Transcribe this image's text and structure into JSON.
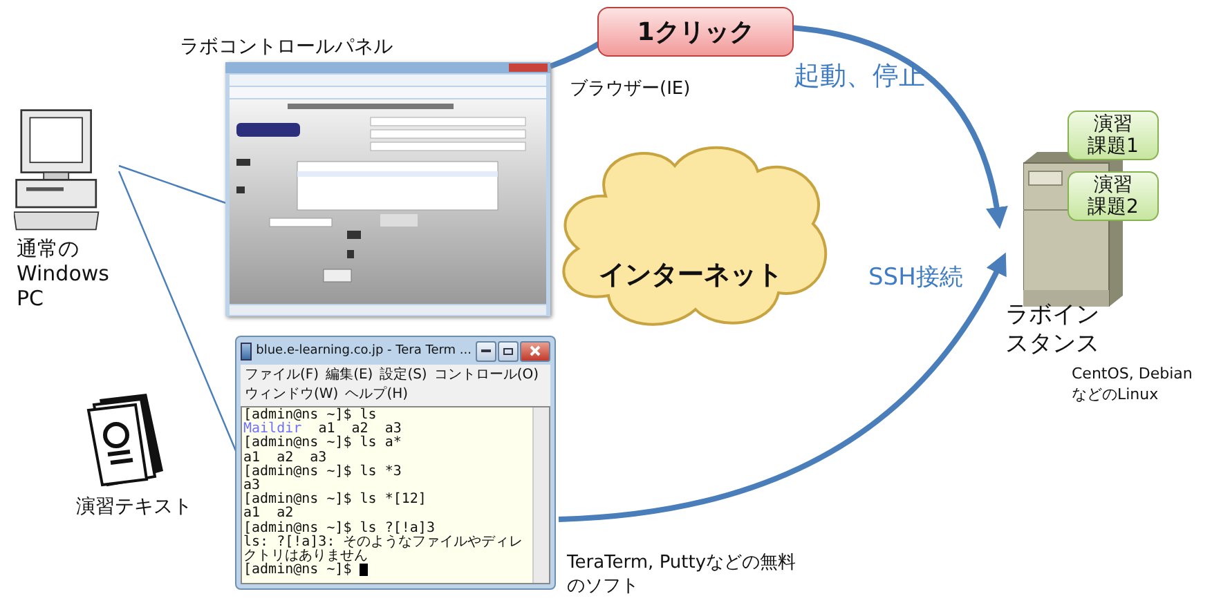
{
  "control_panel": {
    "caption": "ラボコントロールパネル",
    "browser_caption": "ブラウザー(IE)"
  },
  "one_click": {
    "label": "1クリック"
  },
  "start_stop_label": "起動、停止",
  "internet": {
    "label": "インターネット"
  },
  "ssh_label": "SSH接続",
  "client_pc": {
    "label": [
      "通常の",
      "Windows",
      "PC"
    ]
  },
  "textbook": {
    "label": "演習テキスト"
  },
  "terminal": {
    "title": "blue.e-learning.co.jp - Tera Term ...",
    "menu_rows": [
      [
        "ファイル(F)",
        "編集(E)",
        "設定(S)",
        "コントロール(O)"
      ],
      [
        "ウィンドウ(W)",
        "ヘルプ(H)"
      ]
    ],
    "lines": [
      {
        "parts": [
          {
            "kind": "plain",
            "text": "[admin@ns ~]$ ls"
          }
        ],
        "cursor": false
      },
      {
        "parts": [
          {
            "kind": "dir",
            "text": "Maildir"
          },
          {
            "kind": "plain",
            "text": "  a1  a2  a3"
          }
        ],
        "cursor": false
      },
      {
        "parts": [
          {
            "kind": "plain",
            "text": "[admin@ns ~]$ ls a*"
          }
        ],
        "cursor": false
      },
      {
        "parts": [
          {
            "kind": "plain",
            "text": "a1  a2  a3"
          }
        ],
        "cursor": false
      },
      {
        "parts": [
          {
            "kind": "plain",
            "text": "[admin@ns ~]$ ls *3"
          }
        ],
        "cursor": false
      },
      {
        "parts": [
          {
            "kind": "plain",
            "text": "a3"
          }
        ],
        "cursor": false
      },
      {
        "parts": [
          {
            "kind": "plain",
            "text": "[admin@ns ~]$ ls *[12]"
          }
        ],
        "cursor": false
      },
      {
        "parts": [
          {
            "kind": "plain",
            "text": "a1  a2"
          }
        ],
        "cursor": false
      },
      {
        "parts": [
          {
            "kind": "plain",
            "text": "[admin@ns ~]$ ls ?[!a]3"
          }
        ],
        "cursor": false
      },
      {
        "parts": [
          {
            "kind": "plain",
            "text": "ls: ?[!a]3: そのようなファイルやディレ"
          }
        ],
        "cursor": false
      },
      {
        "parts": [
          {
            "kind": "plain",
            "text": "クトリはありません"
          }
        ],
        "cursor": false
      },
      {
        "parts": [
          {
            "kind": "plain",
            "text": "[admin@ns ~]$ "
          }
        ],
        "cursor": true
      }
    ],
    "caption": [
      "TeraTerm, Puttyなどの無料",
      "のソフト"
    ]
  },
  "lab_instance": {
    "label": [
      "ラボイン",
      "スタンス"
    ],
    "os_note": [
      "CentOS, Debian",
      "などのLinux"
    ],
    "exercises": [
      {
        "lines": [
          "演習",
          "課題1"
        ]
      },
      {
        "lines": [
          "演習",
          "課題2"
        ]
      }
    ]
  }
}
